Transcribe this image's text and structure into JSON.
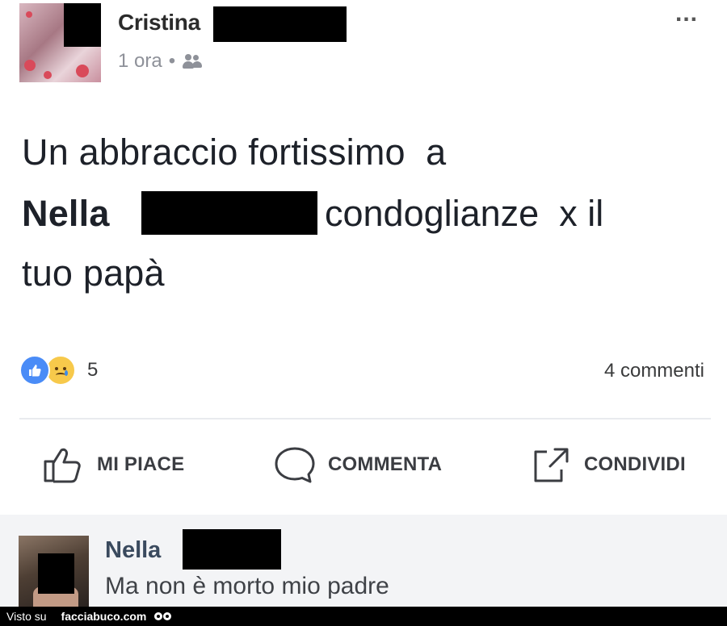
{
  "post": {
    "author": "Cristina",
    "time": "1 ora",
    "separator": "•",
    "privacy_icon": "friends-icon",
    "more": "...",
    "text_line1": "Un abbraccio fortissimo  a",
    "text_line2_bold": "Nella",
    "text_line2_rest": "condoglianze  x il",
    "text_line3": "tuo papà",
    "reactions": {
      "icons": [
        "like-icon",
        "sad-icon"
      ],
      "count": "5",
      "like_color": "#4a8cf7",
      "sad_color": "#f7c94b"
    },
    "comments_count": "4 commenti",
    "actions": {
      "like": "MI PIACE",
      "comment": "COMMENTA",
      "share": "CONDIVIDI"
    }
  },
  "comment": {
    "author": "Nella",
    "text": "Ma non è morto mio padre"
  },
  "footer": {
    "prefix": "Visto su",
    "site": "facciabuco.com"
  }
}
